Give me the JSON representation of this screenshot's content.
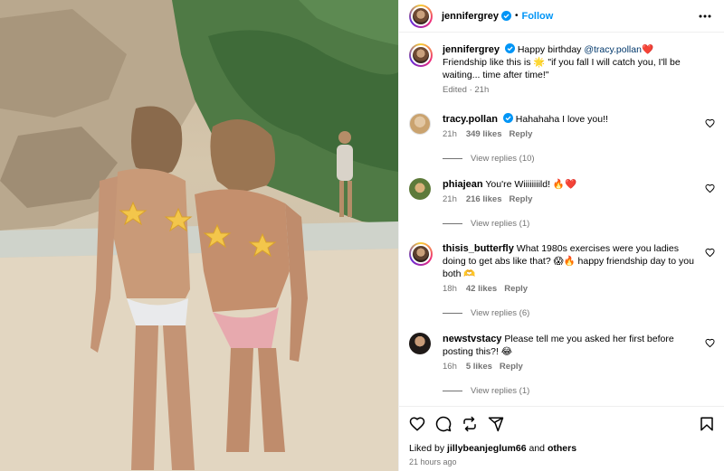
{
  "header": {
    "username": "jennifergrey",
    "separator": "•",
    "follow_label": "Follow"
  },
  "caption": {
    "username": "jennifergrey",
    "text_part1": "Happy birthday ",
    "mention": "@tracy.pollan",
    "emoji_heart": "❤️",
    "text_part2": "Friendship like this is 🌟 \"if you fall I will catch you, I'll be waiting... time after time!\"",
    "edited": "Edited",
    "time": "21h"
  },
  "comments": [
    {
      "username": "tracy.pollan",
      "verified": true,
      "text": "Hahahaha I love you!!",
      "time": "21h",
      "likes": "349 likes",
      "reply_label": "Reply",
      "view_replies": "View replies (10)"
    },
    {
      "username": "phiajean",
      "verified": false,
      "text": "You're Wiiiiiiiild! 🔥❤️",
      "time": "21h",
      "likes": "216 likes",
      "reply_label": "Reply",
      "view_replies": "View replies (1)"
    },
    {
      "username": "thisis_butterfly",
      "verified": false,
      "text": "What 1980s exercises were you ladies doing to get abs like that? 😱🔥 happy friendship day to you both 🫶",
      "time": "18h",
      "likes": "42 likes",
      "reply_label": "Reply",
      "view_replies": "View replies (6)"
    },
    {
      "username": "newstvstacy",
      "verified": false,
      "text": "Please tell me you asked her first before posting this?! 😂",
      "time": "16h",
      "likes": "5 likes",
      "reply_label": "Reply",
      "view_replies": "View replies (1)"
    }
  ],
  "footer": {
    "liked_by_prefix": "Liked by ",
    "liked_by_user": "jillybeanjeglum66",
    "liked_by_suffix": " and ",
    "liked_by_others": "others",
    "posted_ago": "21 hours ago"
  },
  "icons": [
    "verified-icon",
    "more-options-icon",
    "like-icon",
    "comment-icon",
    "repost-icon",
    "share-icon",
    "save-icon",
    "comment-like-icon"
  ],
  "colors": {
    "follow": "#0095f6",
    "mention": "#00376b",
    "secondary_text": "#737373",
    "verified": "#0095f6"
  }
}
